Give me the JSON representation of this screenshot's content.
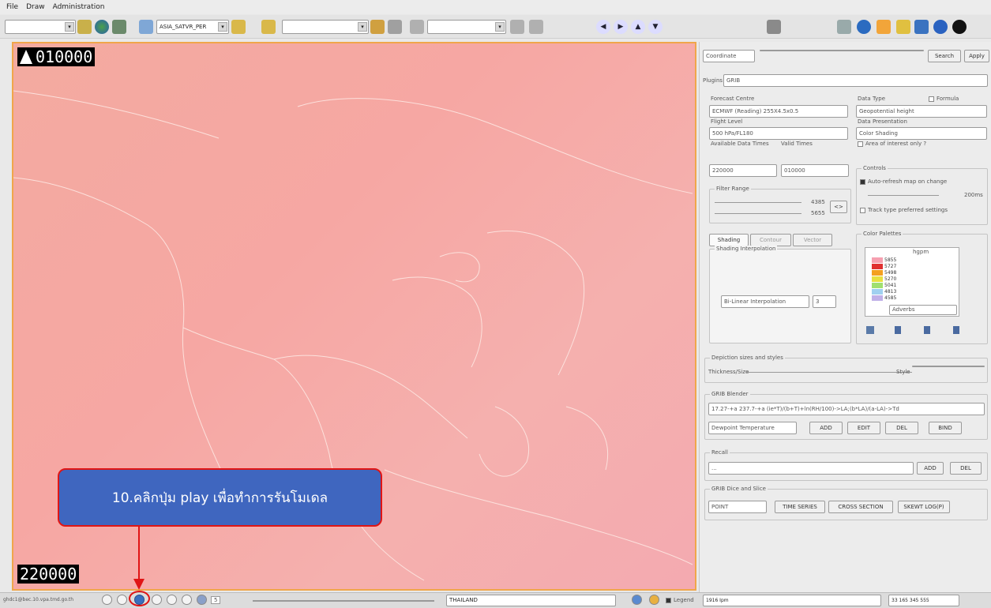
{
  "menu": {
    "file": "File",
    "draw": "Draw",
    "administration": "Administration"
  },
  "toolbar": {
    "layer_combo": "ASIA_SATVR_PER"
  },
  "map": {
    "top_code": "010000",
    "bottom_code": "220000"
  },
  "callout": {
    "text": "10.คลิกปุ่ม play เพื่อทำการรันโมเดล"
  },
  "statusbar": {
    "server": "ghdc1@bec.10.vpa.tmd.go.th",
    "frame": "5",
    "region": "THAILAND",
    "legend": "Legend",
    "left_readout": "1916 Ipm",
    "right_readout": "33 165  345 555"
  },
  "panel": {
    "coord_select": "Coordinate",
    "search": "Search",
    "apply": "Apply",
    "plugins_label": "Plugins",
    "plugins_value": "GRIB",
    "forecast_centre_label": "Forecast Centre",
    "forecast_centre_value": "ECMWF (Reading) 255X4.5x0.5",
    "data_type_label": "Data Type",
    "formula": "Formula",
    "data_type_value": "Geopotential height",
    "flight_level_label": "Flight Level",
    "flight_level_value": "500 hPa/FL180",
    "data_presentation_label": "Data Presentation",
    "data_presentation_value": "Color Shading",
    "available_times": "Available Data Times",
    "valid_times": "Valid Times",
    "area_interest": "Area of interest only ?",
    "time_value": "220000",
    "valid_value": "010000",
    "controls": "Controls",
    "auto_refresh": "Auto-refresh map on change",
    "refresh_ms": "200ms",
    "track_type": "Track type preferred settings",
    "filter_range": "Filter Range",
    "range_max": "4385",
    "range_min": "5655",
    "tab_shading": "Shading",
    "tab_contour": "Contour",
    "tab_vector": "Vector",
    "shading_interp": "Shading Interpolation",
    "interp_value": "Bi-Linear Interpolation",
    "interp_num": "3",
    "color_palettes": "Color Palettes",
    "palette_unit": "hgpm",
    "palette_values": [
      "5855",
      "5727",
      "5498",
      "5270",
      "5041",
      "4813",
      "4585"
    ],
    "palette_name": "Adverbs",
    "depiction": "Depiction sizes and styles",
    "thickness": "Thickness/Size",
    "style": "Style",
    "grib_blender": "GRIB Blender",
    "blender_formula": "17.27-+a 237.7-+a (ie*T)/(b+T)+ln(RH/100)->LA;(b*LA)/(a-LA)->Td",
    "blender_select": "Dewpoint Temperature",
    "add": "ADD",
    "edit": "EDIT",
    "del": "DEL",
    "bind": "BIND",
    "recall": "Recall",
    "recall_value": "...",
    "recall_add": "ADD",
    "recall_del": "DEL",
    "dice_slice": "GRIB Dice and Slice",
    "point": "POINT",
    "time_series": "TIME SERIES",
    "cross_section": "CROSS SECTION",
    "skewt": "SKEWT LOG(P)"
  },
  "colors": {
    "accent_red": "#e01515",
    "callout_blue": "#3f66bf",
    "map_bg": "#f4a9a6",
    "map_border": "#f0a64a"
  }
}
